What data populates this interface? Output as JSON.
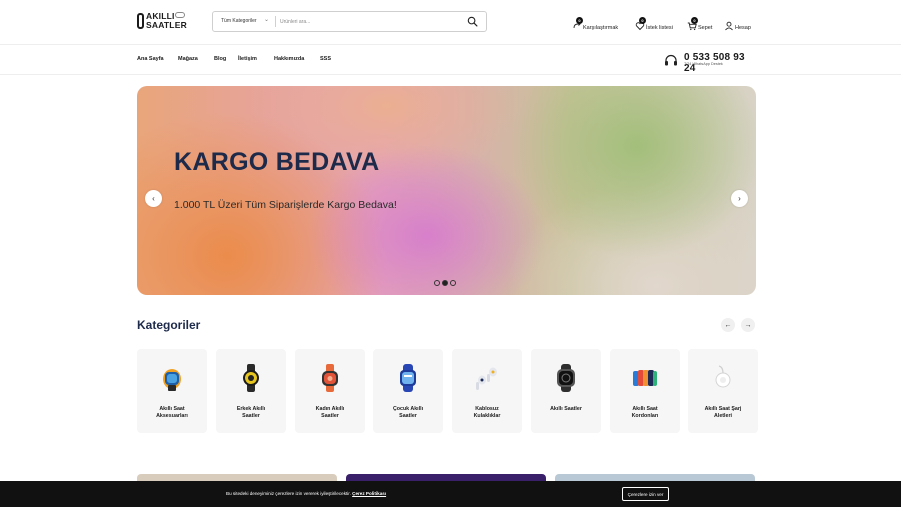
{
  "header": {
    "logo": {
      "line1": "AKILLI",
      "line2": "SAATLER"
    },
    "search": {
      "category_label": "Tüm Kategoriler",
      "placeholder": "Ürünleri ara..."
    },
    "actions": {
      "compare": {
        "label": "Karşılaştırmak",
        "count": "0"
      },
      "wishlist": {
        "label": "İstek listesi",
        "count": "0"
      },
      "cart": {
        "label": "Sepet",
        "count": "0"
      },
      "account": {
        "label": "Hesap"
      }
    }
  },
  "nav": {
    "items": [
      "Ana Sayfa",
      "Mağaza",
      "Blog",
      "İletişim",
      "Hakkımızda",
      "SSS"
    ],
    "phone": {
      "number": "0 533 508 93 24",
      "subtitle": "7/24 WhatsApp Destek"
    }
  },
  "hero": {
    "title": "KARGO BEDAVA",
    "subtitle": "1.000 TL Üzeri Tüm Siparişlerde Kargo Bedava!",
    "prev": "‹",
    "next": "›",
    "slide_count": 3,
    "active_slide": 2
  },
  "categories": {
    "title": "Kategoriler",
    "prev": "←",
    "next": "→",
    "items": [
      {
        "line1": "Akıllı Saat",
        "line2": "Aksesuarları",
        "icon": "watch-accessory-icon"
      },
      {
        "line1": "Erkek Akıllı",
        "line2": "Saatler",
        "icon": "mens-watch-icon"
      },
      {
        "line1": "Kadın Akıllı",
        "line2": "Saatler",
        "icon": "womens-watch-icon"
      },
      {
        "line1": "Çocuk Akıllı",
        "line2": "Saatler",
        "icon": "kids-watch-icon"
      },
      {
        "line1": "Kablosuz",
        "line2": "Kulaklıklar",
        "icon": "earbuds-icon"
      },
      {
        "line1": "Akıllı Saatler",
        "line2": "",
        "icon": "smartwatch-icon"
      },
      {
        "line1": "Akıllı Saat",
        "line2": "Kordonları",
        "icon": "watch-bands-icon"
      },
      {
        "line1": "Akıllı Saat Şarj",
        "line2": "Aletleri",
        "icon": "charger-icon"
      }
    ]
  },
  "cookie": {
    "text": "Bu sitedeki deneyiminiz çerezlere izin vererek iyileştirilecektir.",
    "link": "Çerez Politikası",
    "button": "Çerezlere izin ver"
  },
  "colors": {
    "brand_navy": "#1d2a4a",
    "cookie_bar": "#111111"
  }
}
